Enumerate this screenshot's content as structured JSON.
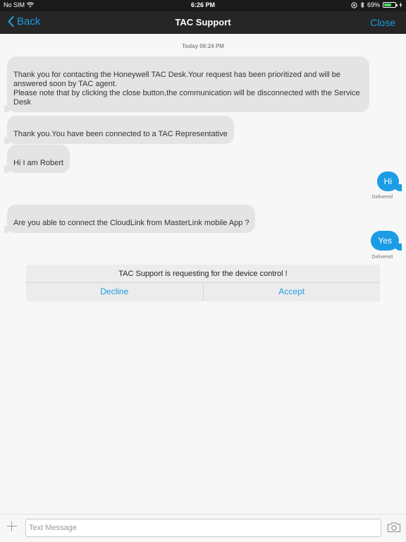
{
  "status_bar": {
    "carrier": "No SIM",
    "time": "6:26 PM",
    "battery_percent": "69%",
    "battery_level": 0.69,
    "icons": [
      "wifi-icon",
      "location-icon",
      "bluetooth-icon",
      "battery-icon",
      "charging-icon"
    ]
  },
  "nav": {
    "back_label": "Back",
    "title": "TAC Support",
    "close_label": "Close",
    "accent_color": "#1b9be0"
  },
  "chat": {
    "timestamp": "Today 06:24 PM",
    "messages": [
      {
        "from": "agent",
        "text": "Thank you for contacting the Honeywell TAC Desk.Your request has been prioritized and will be answered soon by TAC agent.\nPlease note that by clicking the close button,the communication will be disconnected with the Service Desk"
      },
      {
        "from": "agent",
        "text": "Thank you.You have been connected to a TAC Representative"
      },
      {
        "from": "agent",
        "text": "Hi I am Robert"
      },
      {
        "from": "user",
        "text": "Hi",
        "status": "Delivered"
      },
      {
        "from": "agent",
        "text": "Are you able to connect the CloudLink from MasterLink mobile App ?"
      },
      {
        "from": "user",
        "text": "Yes",
        "status": "Delivered"
      }
    ],
    "outgoing_color": "#1c9ce5",
    "incoming_color": "#e4e4e4"
  },
  "control_request": {
    "title": "TAC Support is requesting for the device control !",
    "decline_label": "Decline",
    "accept_label": "Accept"
  },
  "composer": {
    "placeholder": "Text Message",
    "value": ""
  }
}
